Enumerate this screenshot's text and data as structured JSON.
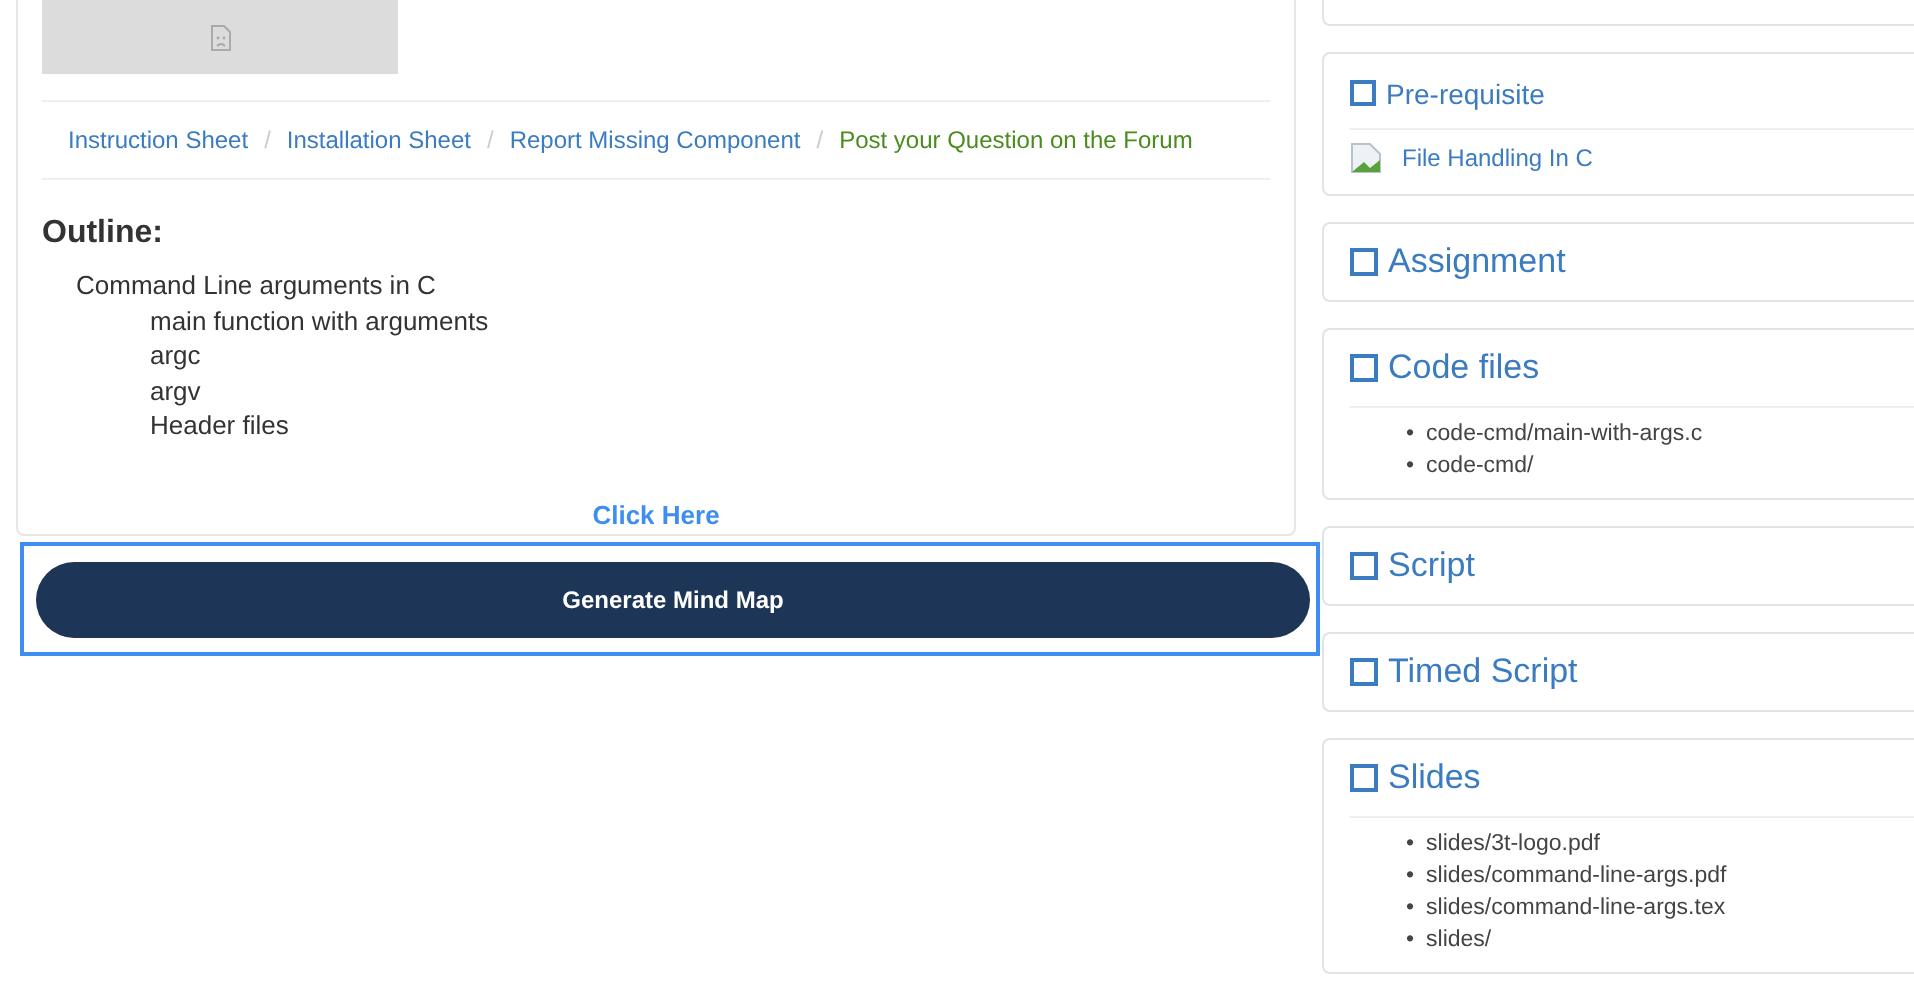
{
  "breadcrumb": [
    {
      "label": "Instruction Sheet",
      "current": false
    },
    {
      "label": "Installation Sheet",
      "current": false
    },
    {
      "label": "Report Missing Component",
      "current": false
    },
    {
      "label": "Post your Question on the Forum",
      "current": true
    }
  ],
  "separator": "/",
  "bullet": "•",
  "outline": {
    "heading": "Outline:",
    "items": [
      {
        "text": "Command Line arguments in C",
        "children": [
          {
            "text": "main function with arguments"
          },
          {
            "text": "argc"
          },
          {
            "text": "argv"
          },
          {
            "text": "Header files"
          }
        ]
      }
    ]
  },
  "click_link": "Click Here",
  "mind_map_button": {
    "label": "Generate Mind Map",
    "focused": true
  },
  "panels": [
    {
      "kind": "stub"
    },
    {
      "kind": "small",
      "title": "Pre-requisite",
      "links": [
        "File Handling In C"
      ]
    },
    {
      "kind": "large",
      "title": "Assignment"
    },
    {
      "kind": "large",
      "title": "Code files",
      "files": [
        "code-cmd/main-with-args.c",
        "code-cmd/"
      ]
    },
    {
      "kind": "large",
      "title": "Script"
    },
    {
      "kind": "large",
      "title": "Timed Script"
    },
    {
      "kind": "large",
      "title": "Slides",
      "files": [
        "slides/3t-logo.pdf",
        "slides/command-line-args.pdf",
        "slides/command-line-args.tex",
        "slides/"
      ]
    }
  ]
}
